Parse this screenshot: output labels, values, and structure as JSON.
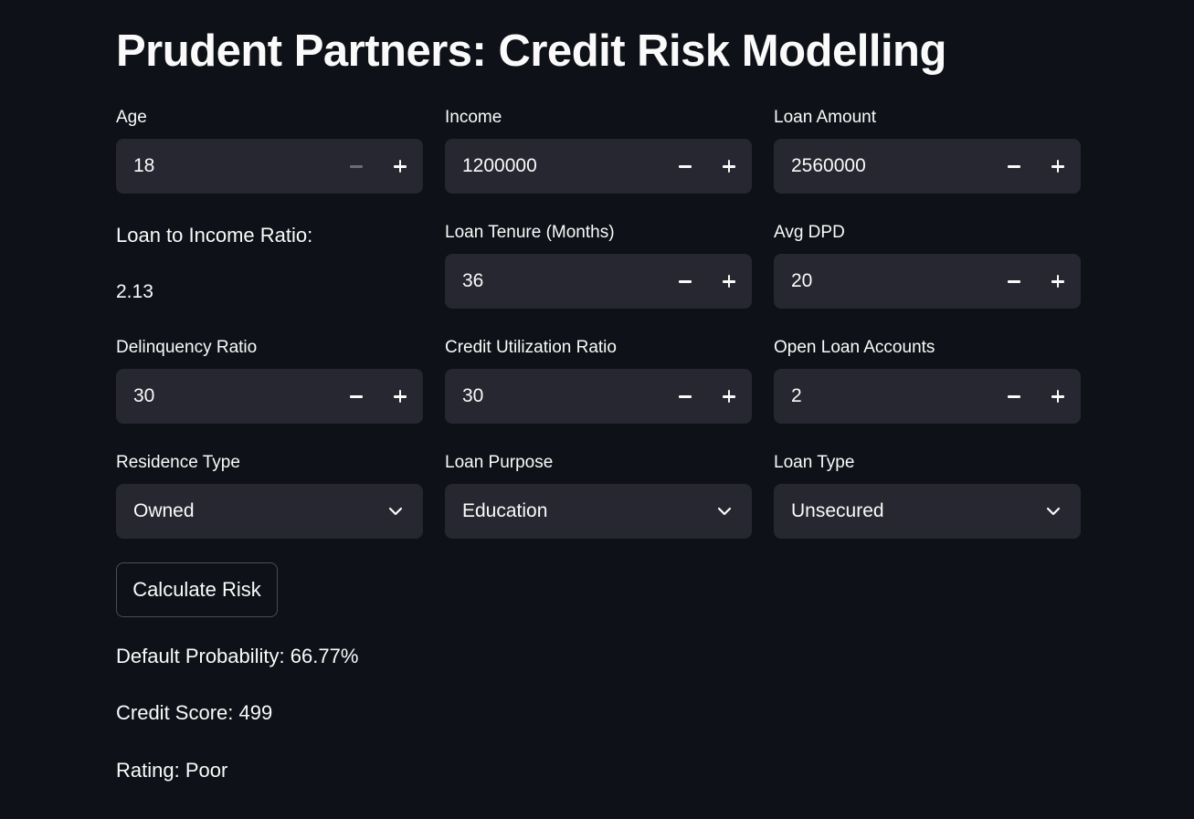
{
  "title": "Prudent Partners: Credit Risk Modelling",
  "fields": {
    "age": {
      "label": "Age",
      "value": "18"
    },
    "income": {
      "label": "Income",
      "value": "1200000"
    },
    "loan_amount": {
      "label": "Loan Amount",
      "value": "2560000"
    },
    "loan_tenure": {
      "label": "Loan Tenure (Months)",
      "value": "36"
    },
    "avg_dpd": {
      "label": "Avg DPD",
      "value": "20"
    },
    "delinquency_ratio": {
      "label": "Delinquency Ratio",
      "value": "30"
    },
    "credit_utilization_ratio": {
      "label": "Credit Utilization Ratio",
      "value": "30"
    },
    "open_loan_accounts": {
      "label": "Open Loan Accounts",
      "value": "2"
    }
  },
  "loan_to_income": {
    "label": "Loan to Income Ratio:",
    "value": "2.13"
  },
  "selects": {
    "residence_type": {
      "label": "Residence Type",
      "value": "Owned"
    },
    "loan_purpose": {
      "label": "Loan Purpose",
      "value": "Education"
    },
    "loan_type": {
      "label": "Loan Type",
      "value": "Unsecured"
    }
  },
  "icons": {
    "minus": "minus-icon",
    "plus": "plus-icon",
    "dropdown": "chevron-down-icon"
  },
  "calculate_button": "Calculate Risk",
  "results": {
    "default_probability": "Default Probability: 66.77%",
    "credit_score": "Credit Score: 499",
    "rating": "Rating: Poor"
  },
  "colors": {
    "background": "#0e1117",
    "input_background": "#262730",
    "text": "#fafafa",
    "disabled_icon": "#6b6d75"
  }
}
